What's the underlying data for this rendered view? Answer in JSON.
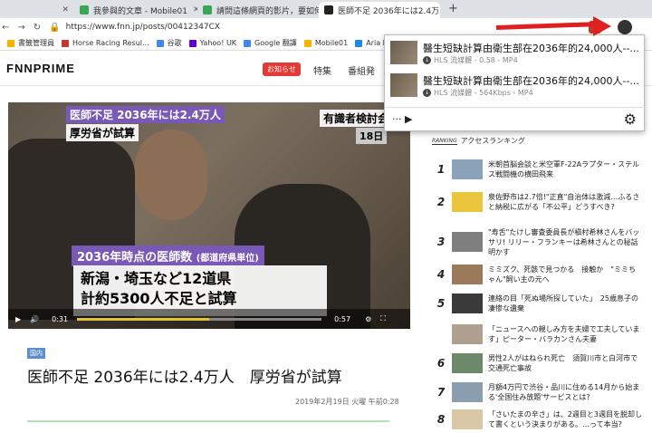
{
  "tabs": [
    {
      "title": "我參與的文章 - Mobile01",
      "color": "#3aa655"
    },
    {
      "title": "請問這條網頁的影片，要如何錄",
      "color": "#3aa655"
    },
    {
      "title": "医師不足 2036年には2.4万人　厚",
      "color": "#222222"
    }
  ],
  "url": "https://www.fnn.jp/posts/00412347CX",
  "bookmarks": [
    {
      "label": "書籤管理員",
      "color": "#f5b400"
    },
    {
      "label": "Horse Racing Resul...",
      "color": "#c0392b"
    },
    {
      "label": "谷歌",
      "color": "#4285f4"
    },
    {
      "label": "Yahoo! UK",
      "color": "#6001d2"
    },
    {
      "label": "Google 翻譯",
      "color": "#4285f4"
    },
    {
      "label": "Mobile01",
      "color": "#f5b400"
    },
    {
      "label": "Aria PC - 電腦硬件...",
      "color": "#1e88e5"
    }
  ],
  "site": {
    "logo": "FNNPRIME",
    "notice": "お知らせ",
    "nav": [
      "特集",
      "番組発"
    ]
  },
  "video": {
    "cap_title": "医師不足 2036年には2.4万人",
    "cap_sub": "厚労省が試算",
    "cap_right": "有識者検討会",
    "cap_day": "18日",
    "cap_section": "2036年時点の医師数",
    "cap_section_sub": "(都道府県単位)",
    "cap_main1": "新潟・埼玉など12道県",
    "cap_main2": "計約5300人不足と試算",
    "time_current": "0:31",
    "time_total": "0:57",
    "progress": 0.54
  },
  "article": {
    "tag": "国内",
    "title": "医師不足 2036年には2.4万人　厚労省が試算",
    "date": "2019年2月19日 火曜 午前0:28"
  },
  "ranking": {
    "badge": "RANKING",
    "title": "アクセスランキング",
    "items": [
      {
        "num": "1",
        "text": "米朝首脳会談と米空軍F-22Aラプター・ステルス戦闘機の横田飛来",
        "thumb": "#8aa3b8"
      },
      {
        "num": "2",
        "text": "泉佐野市は2.7倍!\"正直\"自治体は激減…ふるさと納税に広がる「不公平」どうすべき?",
        "thumb": "#e8c53a"
      },
      {
        "num": "3",
        "text": "\"寿舌\"たけし審査委員長が槇村希林さんをバッサリ! リリー・フランキーは希林さんとの秘話明かす",
        "thumb": "#7f7f7f"
      },
      {
        "num": "4",
        "text": "ミミズク、死骸で見つかる　接触か　\"ミミちゃん\"飼い主の元へ",
        "thumb": "#9a7a5a"
      },
      {
        "num": "5",
        "text": "連絡の目「死ぬ場所探していた」　25歳息子の凄惨な遺棄",
        "thumb": "#3a3a3a"
      },
      {
        "num": "",
        "text": "「ニュースへの親しみ方を夫婦で工夫しています」ピーター・バラカンさん夫妻",
        "thumb": "#b0a090"
      },
      {
        "num": "6",
        "text": "男性2人がはねられ死亡　須賀川市と白河市で交通死亡事故",
        "thumb": "#6c8a6a"
      },
      {
        "num": "7",
        "text": "月額4万円で渋谷・品川に住める14月から始まる'全国住み放題'サービスとは?",
        "thumb": "#8b9eb0"
      },
      {
        "num": "8",
        "text": "「さいたまの辛さ」は、2週目と3週目を脱却して書くという決まりがある。…って本当?",
        "thumb": "#d9c7a5"
      }
    ]
  },
  "popup": {
    "items": [
      {
        "title": "醫生短缺計算由衛生部在2036年的24,000人--...",
        "meta": "HLS 流媒體 - 0.58 - MP4"
      },
      {
        "title": "醫生短缺計算由衛生部在2036年的24,000人--...",
        "meta": "HLS 流媒體 - 564Kbps - MP4"
      }
    ]
  },
  "colors": {
    "accent_red": "#e02020",
    "tab_bar": "#dee1e6"
  }
}
